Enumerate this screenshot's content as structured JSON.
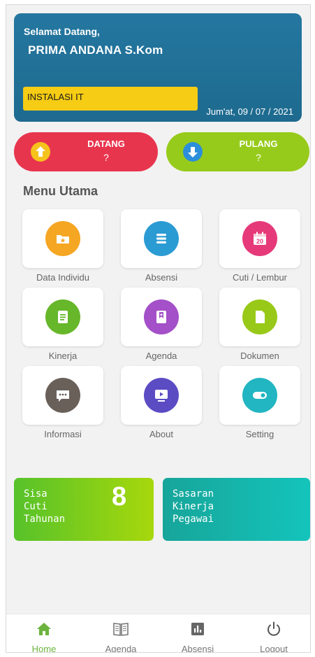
{
  "header": {
    "welcome": "Selamat Datang,",
    "username": "PRIMA ANDANA S.Kom",
    "unit": "INSTALASI IT",
    "date": "Jum'at, 09 / 07 / 2021"
  },
  "attendance": {
    "datang": {
      "label": "DATANG",
      "status": "?",
      "color": "#e8354e",
      "icon": "arrow-up-icon"
    },
    "pulang": {
      "label": "PULANG",
      "status": "?",
      "color": "#97cb1b",
      "icon": "arrow-down-icon"
    }
  },
  "menu": {
    "title": "Menu Utama",
    "items": [
      {
        "label": "Data Individu",
        "icon": "star-folder-icon",
        "color": "#f5a623"
      },
      {
        "label": "Absensi",
        "icon": "list-icon",
        "color": "#2b9bd3"
      },
      {
        "label": "Cuti / Lembur",
        "icon": "calendar-icon",
        "color": "#e6397a",
        "icon_text": "20"
      },
      {
        "label": "Kinerja",
        "icon": "document-icon",
        "color": "#66b72a"
      },
      {
        "label": "Agenda",
        "icon": "bookmark-icon",
        "color": "#a450c8"
      },
      {
        "label": "Dokumen",
        "icon": "file-icon",
        "color": "#98c918"
      },
      {
        "label": "Informasi",
        "icon": "chat-icon",
        "color": "#6a605a"
      },
      {
        "label": "About",
        "icon": "play-icon",
        "color": "#5b4cc4"
      },
      {
        "label": "Setting",
        "icon": "toggle-icon",
        "color": "#22b5c2"
      }
    ]
  },
  "cards": {
    "cuti": {
      "line1": "Sisa",
      "line2": "Cuti",
      "line3": "Tahunan",
      "value": "8"
    },
    "sasaran": {
      "line1": "Sasaran",
      "line2": "Kinerja",
      "line3": "Pegawai"
    }
  },
  "nav": {
    "items": [
      {
        "label": "Home",
        "icon": "home-icon",
        "active": true
      },
      {
        "label": "Agenda",
        "icon": "book-icon",
        "active": false
      },
      {
        "label": "Absensi",
        "icon": "bar-chart-icon",
        "active": false
      },
      {
        "label": "Logout",
        "icon": "power-icon",
        "active": false
      }
    ]
  },
  "colors": {
    "header_bg": "#1f6a8d",
    "unit_badge": "#f6cc14",
    "active_nav": "#6cb33e"
  }
}
